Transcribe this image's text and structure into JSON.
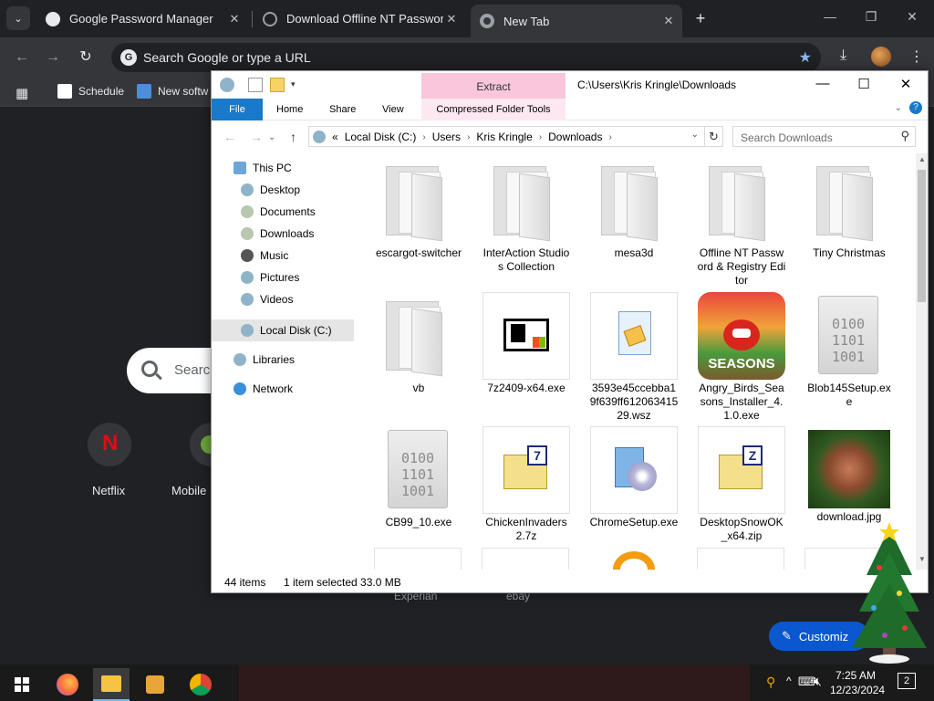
{
  "chrome": {
    "tabs": [
      {
        "label": "Google Password Manager",
        "close": "✕",
        "icon_color": "#e8eaed"
      },
      {
        "label": "Download Offline NT Password",
        "close": "✕",
        "icon_color": "#9aa0a6"
      },
      {
        "label": "New Tab",
        "close": "✕",
        "icon_color": "#9aa0a6"
      }
    ],
    "new_tab": "+",
    "window_controls": [
      "—",
      "❐",
      "✕"
    ],
    "omnibox_placeholder": "Search Google or type a URL",
    "bookmarks": [
      {
        "label": "Schedule"
      },
      {
        "label": "New softw"
      }
    ],
    "ntp": {
      "search_placeholder": "Search",
      "shortcuts": [
        {
          "label": "Netflix"
        },
        {
          "label": "Mobile"
        }
      ],
      "bottom_shortcuts": [
        "Experian",
        "ebay"
      ],
      "customize_label": "Customiz"
    }
  },
  "explorer": {
    "extract_tab": "Extract",
    "path_title": "C:\\Users\\Kris Kringle\\Downloads",
    "ribbon": {
      "file": "File",
      "tabs": [
        "Home",
        "Share",
        "View"
      ],
      "compressed": "Compressed Folder Tools",
      "help": "?"
    },
    "breadcrumb": [
      "«",
      "Local Disk (C:)",
      "Users",
      "Kris Kringle",
      "Downloads"
    ],
    "search_placeholder": "Search Downloads",
    "nav": [
      {
        "label": "This PC",
        "icon": "pc-icon",
        "level": 0
      },
      {
        "label": "Desktop",
        "icon": "desktop-icon",
        "level": 1
      },
      {
        "label": "Documents",
        "icon": "documents-icon",
        "level": 1
      },
      {
        "label": "Downloads",
        "icon": "downloads-icon",
        "level": 1
      },
      {
        "label": "Music",
        "icon": "music-icon",
        "level": 1
      },
      {
        "label": "Pictures",
        "icon": "pictures-icon",
        "level": 1
      },
      {
        "label": "Videos",
        "icon": "videos-icon",
        "level": 1
      },
      {
        "label": "Local Disk (C:)",
        "icon": "disk-icon",
        "level": 1,
        "selected": true
      },
      {
        "label": "Libraries",
        "icon": "libraries-icon",
        "level": 0
      },
      {
        "label": "Network",
        "icon": "network-icon",
        "level": 0
      }
    ],
    "files": [
      {
        "name": "escargot-switcher",
        "kind": "folder"
      },
      {
        "name": "InterAction Studios Collection",
        "kind": "folder"
      },
      {
        "name": "mesa3d",
        "kind": "folder"
      },
      {
        "name": "Offline NT Password & Registry Editor",
        "kind": "folder"
      },
      {
        "name": "Tiny Christmas",
        "kind": "folder"
      },
      {
        "name": "vb",
        "kind": "folder"
      },
      {
        "name": "7z2409-x64.exe",
        "kind": "7z-exe"
      },
      {
        "name": "3593e45ccebba19f639ff61206341529.wsz",
        "kind": "wsz"
      },
      {
        "name": "Angry_Birds_Seasons_Installer_4.1.0.exe",
        "kind": "angry-birds"
      },
      {
        "name": "Blob145Setup.exe",
        "kind": "binary"
      },
      {
        "name": "CB99_10.exe",
        "kind": "binary"
      },
      {
        "name": "ChickenInvaders2.7z",
        "kind": "7z-archive"
      },
      {
        "name": "ChromeSetup.exe",
        "kind": "setup"
      },
      {
        "name": "DesktopSnowOK_x64.zip",
        "kind": "zip"
      },
      {
        "name": "download.jpg",
        "kind": "photo"
      }
    ],
    "status": {
      "count": "44 items",
      "selection": "1 item selected  33.0 MB"
    }
  },
  "taskbar": {
    "time": "7:25 AM",
    "date": "12/23/2024",
    "notification_count": "2"
  }
}
